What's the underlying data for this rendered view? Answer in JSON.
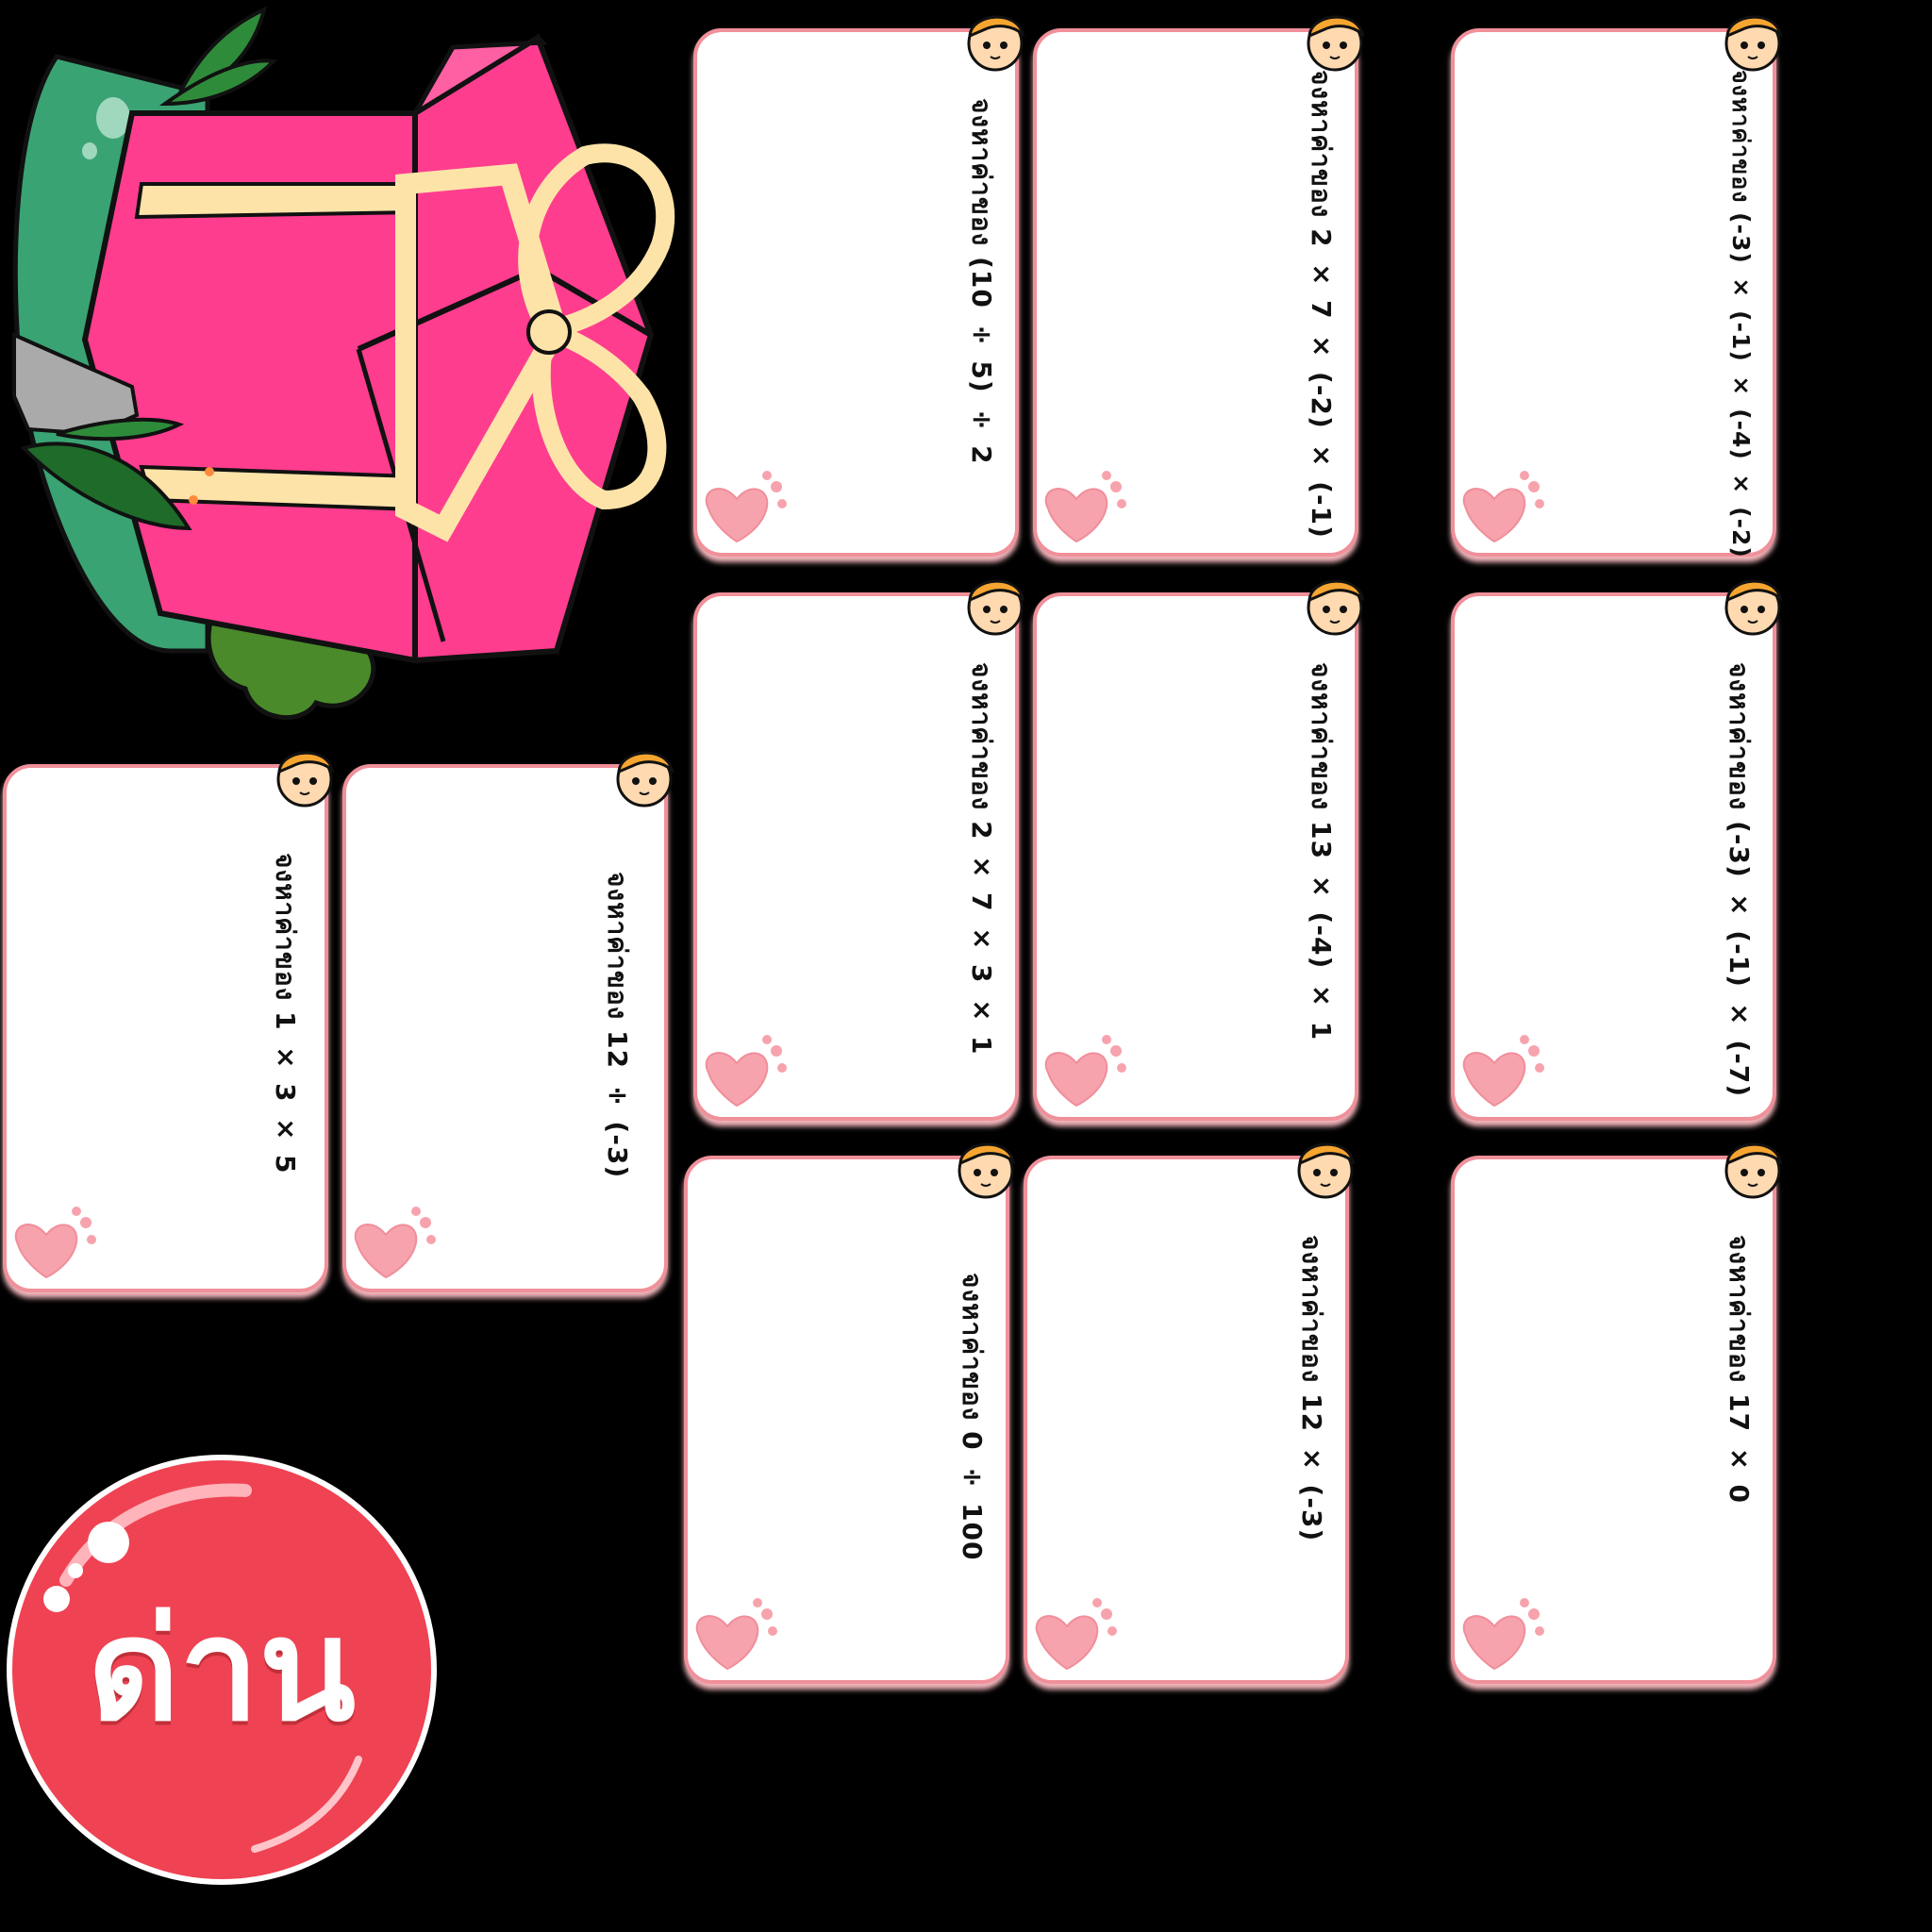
{
  "cards": [
    {
      "question": "จงหาค่าของ (10 ÷ 5) ÷ 2"
    },
    {
      "question": "จงหาค่าของ 2 × 7 × (-2) × (-1)"
    },
    {
      "question": "จงหาค่าของ (-3) × (-1) × (-4) × (-2)"
    },
    {
      "question": "จงหาค่าของ 2 × 7 × 3 × 1"
    },
    {
      "question": "จงหาค่าของ 13 × (-4) × 1"
    },
    {
      "question": "จงหาค่าของ (-3) × (-1) × (-7)"
    },
    {
      "question": "จงหาค่าของ  1 × 3 × 5"
    },
    {
      "question": "จงหาค่าของ 12 ÷ (-3)"
    },
    {
      "question": "จงหาค่าของ 0 ÷ 100"
    },
    {
      "question": "จงหาค่าของ 12 × (-3)"
    },
    {
      "question": "จงหาค่าของ 17 × 0"
    }
  ],
  "stage_button": {
    "label": "ด่าน"
  },
  "colors": {
    "card_border": "#f0909a",
    "gift_pink": "#ff3d8f",
    "ribbon": "#fde3a8",
    "bush": "#3aa373",
    "button_red": "#ef4252"
  }
}
